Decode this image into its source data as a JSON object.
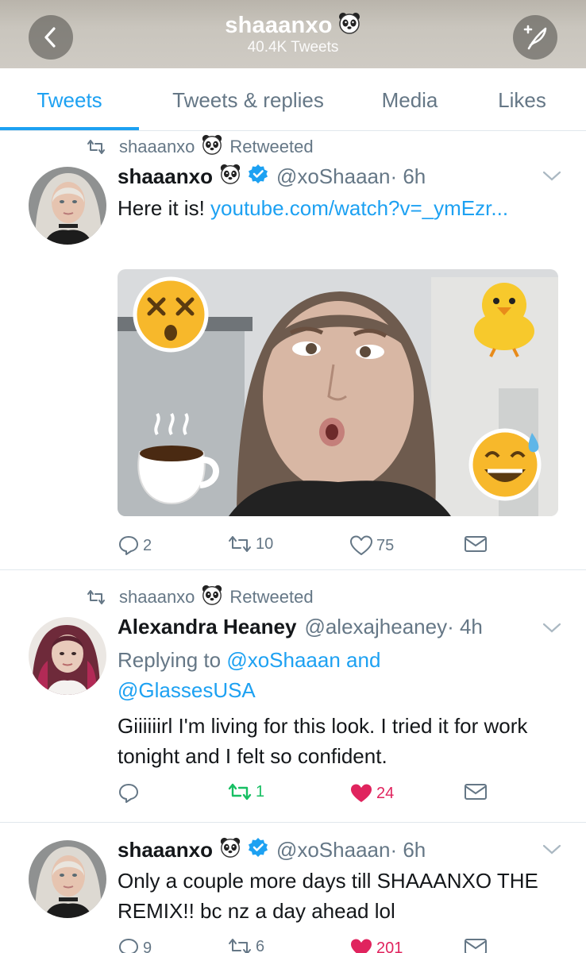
{
  "header": {
    "title": "shaaanxo",
    "subtitle": "40.4K Tweets",
    "back_icon": "chevron-left-icon",
    "compose_icon": "compose-feather-icon"
  },
  "tabs": [
    {
      "label": "Tweets",
      "active": true
    },
    {
      "label": "Tweets & replies",
      "active": false
    },
    {
      "label": "Media",
      "active": false
    },
    {
      "label": "Likes",
      "active": false
    }
  ],
  "colors": {
    "accent": "#1da1f2",
    "muted": "#657786",
    "retweet_green": "#17bf63",
    "like_red": "#e0245e"
  },
  "tweets": [
    {
      "retweeted_by": "shaaanxo",
      "retweeted_label": "Retweeted",
      "name": "shaaanxo",
      "handle": "@xoShaaan",
      "time": "· 6h",
      "text": "Here it is! ",
      "link": "youtube.com/watch?v=_ymEzr...",
      "replies": "2",
      "retweets": "10",
      "likes": "75"
    },
    {
      "retweeted_by": "shaaanxo",
      "retweeted_label": "Retweeted",
      "name": "Alexandra Heaney",
      "handle": "@alexajheaney",
      "time": "· 4h",
      "replying_label": "Replying to ",
      "replying_to": "@xoShaaan and @GlassesUSA",
      "text": "Giiiiiirl I'm living for this look. I tried it for work tonight and I felt so confident.",
      "replies": "",
      "retweets": "1",
      "likes": "24"
    },
    {
      "name": "shaaanxo",
      "handle": "@xoShaaan",
      "time": "· 6h",
      "text": "Only a couple more days till SHAAANXO THE REMIX!! bc nz a day ahead lol",
      "replies": "9",
      "retweets": "6",
      "likes": "201"
    }
  ]
}
